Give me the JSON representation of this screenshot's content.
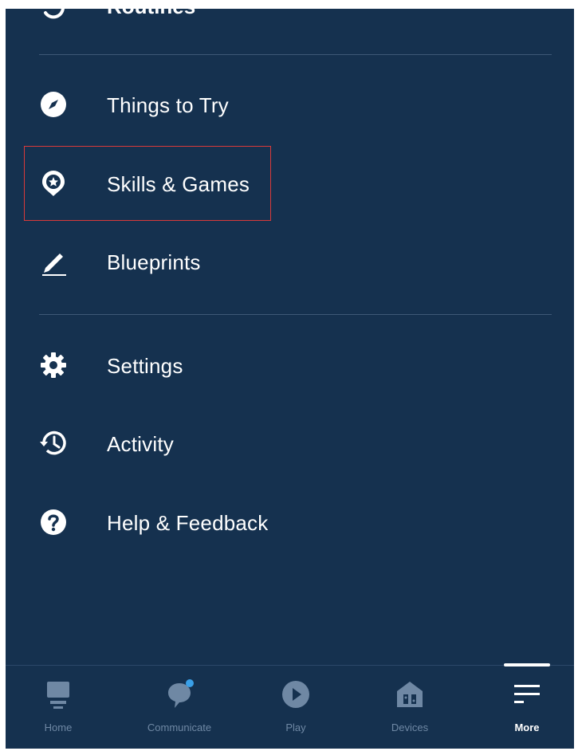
{
  "menu": {
    "cut_item": {
      "label": "Routines",
      "icon": "routines-icon"
    },
    "items": [
      {
        "label": "Things to Try",
        "icon": "compass-icon"
      },
      {
        "label": "Skills & Games",
        "icon": "skills-games-icon"
      },
      {
        "label": "Blueprints",
        "icon": "pencil-icon"
      },
      {
        "label": "Settings",
        "icon": "gear-icon"
      },
      {
        "label": "Activity",
        "icon": "history-icon"
      },
      {
        "label": "Help & Feedback",
        "icon": "help-icon"
      }
    ],
    "highlight_color": "#d93a3a"
  },
  "bottom_nav": {
    "items": [
      {
        "label": "Home",
        "icon": "home-icon",
        "active": false
      },
      {
        "label": "Communicate",
        "icon": "chat-bubble-icon",
        "active": false,
        "notification": true
      },
      {
        "label": "Play",
        "icon": "play-icon",
        "active": false
      },
      {
        "label": "Devices",
        "icon": "devices-icon",
        "active": false
      },
      {
        "label": "More",
        "icon": "menu-icon",
        "active": true
      }
    ]
  },
  "colors": {
    "background": "#15314f",
    "icon_inactive": "#6f88a4",
    "notification_dot": "#3aa0e8"
  }
}
